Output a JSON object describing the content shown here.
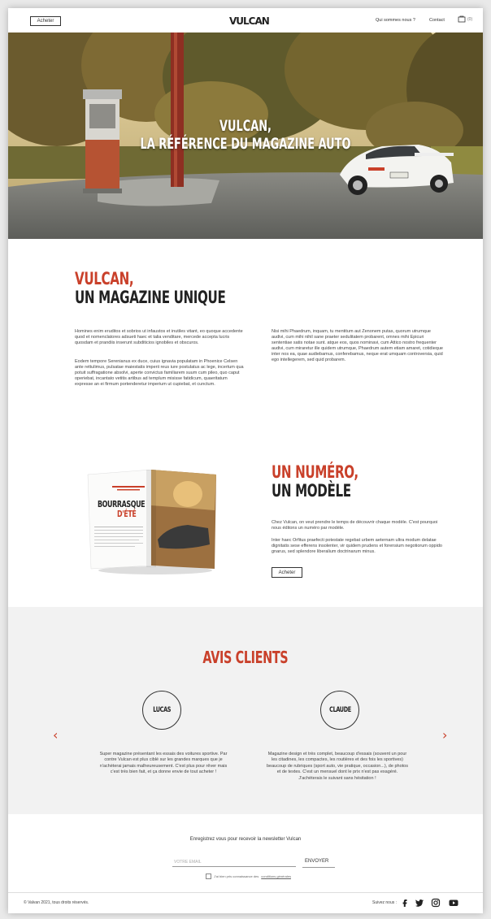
{
  "header": {
    "buy_label": "Acheter",
    "logo": "VULCAN",
    "nav_about": "Qui sommes nous ?",
    "nav_contact": "Contact",
    "cart_count": "(0)"
  },
  "hero": {
    "title_line1": "VULCAN,",
    "title_line2": "LA RÉFÉRENCE DU MAGAZINE AUTO"
  },
  "about": {
    "title_red": "VULCAN,",
    "title_dark": "UN MAGAZINE UNIQUE",
    "p1": "Homines enim eruditos et sobrios ut infaustos et inutiles vitant, eo quoque accedente quod et nomenclatores adsueti haec et talia venditare, mercede accepta lucris quosdam et prandiis inserunt subditicios ignobiles et obscuros.",
    "p2": "Eodem tempore Serenianus ex duce, cuius ignavia populatam in Phoenice Celsen ante rettulimus, pulsatae maiestatis imperii reus iure postulatus ac lege, incertum qua potuit suffragatione absolvi, aperte convictus familiarem suum cum pileo, quo caput operiebat, incantato vetitis artibus ad templum misisse fatidicum, quaeritatum expresse an ei firmum portenderetur imperium ut cupiebat, et cunctum.",
    "p3": "Nisi mihi Phaedrum, inquam, tu mentitum aut Zenonem putas, quorum utrumque audivi, cum mihi nihil sane praeter sedulitatem probarent, omnes mihi Epicuri sententiae satis notae sunt. atque eos, quos nominavi, cum Attico nostro frequenter audivi, cum miraretur ille quidem utrumque, Phaedrum autem etiam amaret, cotidieque inter nos ea, quae audiebamus, conferebamus, neque erat umquam controversia, quid ego intellegerem, sed quid probarem."
  },
  "magazine": {
    "cover_title_1": "BOURRASQUE",
    "cover_title_2": "D'ÉTÉ",
    "title_red": "UN NUMÉRO,",
    "title_dark": "UN MODÈLE",
    "p1": "Chez Vulcan, on veut prendre le temps de découvrir chaque modèle. C'est pourquoi nous éditons un numéro par modèle.",
    "p2": "Inter haec Orfitus praefecti potestate regebat urbem aeternam ultra modum delatae dignitatis sese efferens insolenter, vir quidem prudens et forensium negotiorum oppido gnarus, sed splendore liberalium doctrinarum minus.",
    "buy_label": "Acheter"
  },
  "reviews": {
    "title": "AVIS CLIENTS",
    "items": [
      {
        "name": "LUCAS",
        "text": "Super magazine présentant les essais des voitures sportive. Par contre Vulcan est plus ciblé sur les grandes marques que je n'achèterai jamais malheureusement. C'est plus pour rêver mais c'est très bien fait, et ça donne envie de tout acheter !"
      },
      {
        "name": "CLAUDE",
        "text": "Magazine design et très complet, beaucoup d'essais (souvent un pour les citadines, les compactes, les routières et des fois les sportives) beaucoup de rubriques (sport auto, vie pratique, occasion...), de photos et de textes. C'est un mensuel dont le prix n'est pas exagéré. J'achèterais le suivant sans hésitation !"
      }
    ],
    "prev": "‹",
    "next": "›"
  },
  "newsletter": {
    "title": "Enregistrez vous pour recevoir la newsletter Vulcan",
    "email_placeholder": "VOTRE EMAIL",
    "send_label": "ENVOYER",
    "consent_prefix": "J'ai bien pris connaissance des",
    "consent_link": "conditions générales"
  },
  "footer": {
    "copyright": "© Valvan 2021, tous droits réservés.",
    "follow": "Suivez nous :"
  },
  "colors": {
    "accent": "#c9402a",
    "reviews_bg": "#f2f2f2"
  }
}
